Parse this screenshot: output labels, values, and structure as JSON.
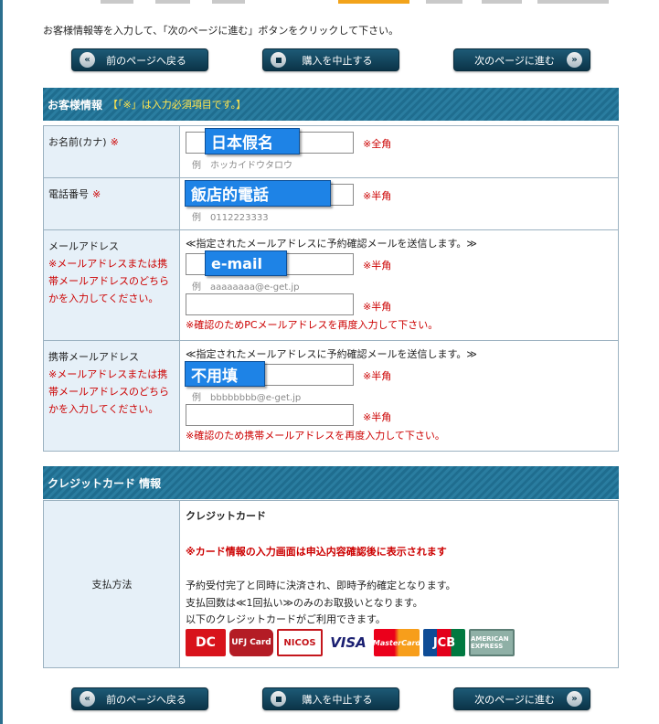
{
  "intro": "お客様情報等を入力して、「次のページに進む」ボタンをクリックして下さい。",
  "nav": {
    "back": "前のページへ戻る",
    "cancel": "購入を中止する",
    "next": "次のページに進む"
  },
  "customer": {
    "title": "お客様情報",
    "required_note": "【「※」は入力必須項目です。】",
    "required_mark": "※",
    "name_kana": {
      "label": "お名前(カナ)",
      "value": "",
      "unit": "※全角",
      "example": "例　ホッカイドウタロウ",
      "callout": "日本假名"
    },
    "phone": {
      "label": "電話番号",
      "value": "",
      "unit": "※半角",
      "example": "例　0112223333",
      "callout": "飯店的電話"
    },
    "email": {
      "label": "メールアドレス",
      "required_note": "※メールアドレスまたは携帯メールアドレスのどちらかを入力してください。",
      "info": "≪指定されたメールアドレスに予約確認メールを送信します。≫",
      "value": "",
      "confirm_value": "",
      "unit": "※半角",
      "unit_confirm": "※半角",
      "example": "例　aaaaaaaa@e-get.jp",
      "confirm_note": "※確認のためPCメールアドレスを再度入力して下さい。",
      "callout": "e-mail"
    },
    "mobile_email": {
      "label": "携帯メールアドレス",
      "required_note": "※メールアドレスまたは携帯メールアドレスのどちらかを入力してください。",
      "info": "≪指定されたメールアドレスに予約確認メールを送信します。≫",
      "value": "",
      "confirm_value": "",
      "unit": "※半角",
      "unit_confirm": "※半角",
      "example": "例　bbbbbbbb@e-get.jp",
      "confirm_note": "※確認のため携帯メールアドレスを再度入力して下さい。",
      "callout": "不用填"
    }
  },
  "credit": {
    "title": "クレジットカード 情報",
    "payment_label": "支払方法",
    "method": "クレジットカード",
    "warning": "※カード情報の入力画面は申込内容確認後に表示されます",
    "line1": "予約受付完了と同時に決済され、即時予約確定となります。",
    "line2": "支払回数は≪1回払い≫のみのお取扱いとなります。",
    "line3": "以下のクレジットカードがご利用できます。",
    "cards": {
      "dc": "DC",
      "ufj": "UFJ Card",
      "nicos": "NICOS",
      "visa": "VISA",
      "mastercard": "MasterCard",
      "jcb": "JCB",
      "amex": "AMERICAN EXPRESS"
    }
  },
  "colors": {
    "section_bar": "#1f6d8f",
    "label_cell": "#e6f0f8",
    "required_red": "#cc0000",
    "callout_blue": "#1e83e6",
    "button_dark": "#0b3448"
  }
}
